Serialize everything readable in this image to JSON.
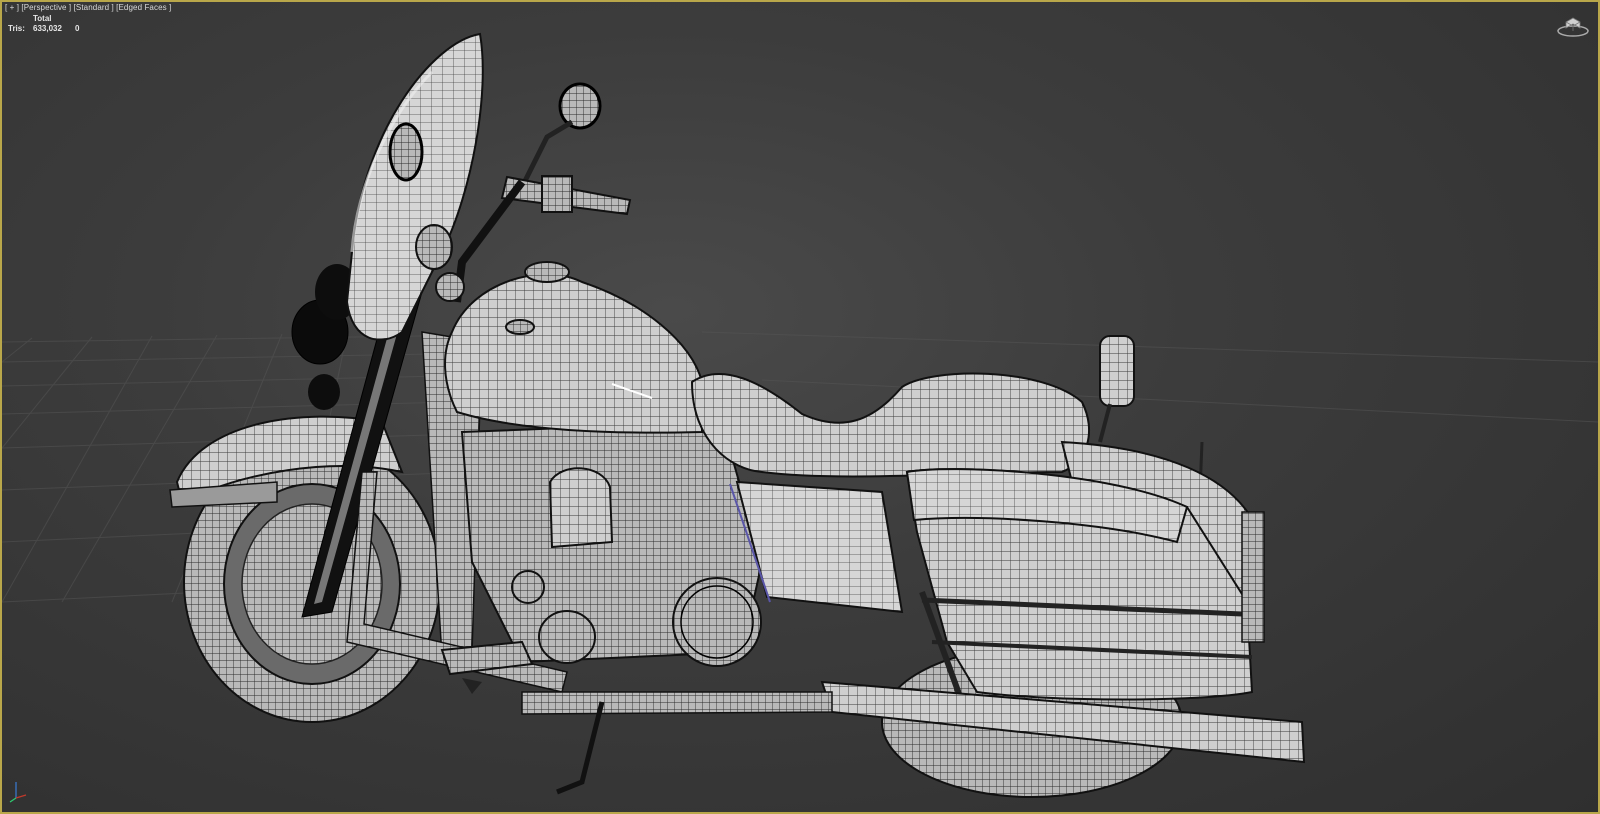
{
  "viewport": {
    "labels": {
      "menu": "[ + ]",
      "view": "[Perspective ]",
      "shading": "[Standard ]",
      "style": "[Edged Faces ]"
    },
    "stats": {
      "header_total": "Total",
      "tris_label": "Tris:",
      "tris_total": "633,032",
      "tris_selected": "0"
    },
    "border_color": "#b9a74a",
    "background_color": "#3c3c3c",
    "viewcube_icon": "viewcube-icon",
    "axis_icon": "axis-tripod-icon",
    "model": "motorcycle wireframe (edged faces)"
  }
}
